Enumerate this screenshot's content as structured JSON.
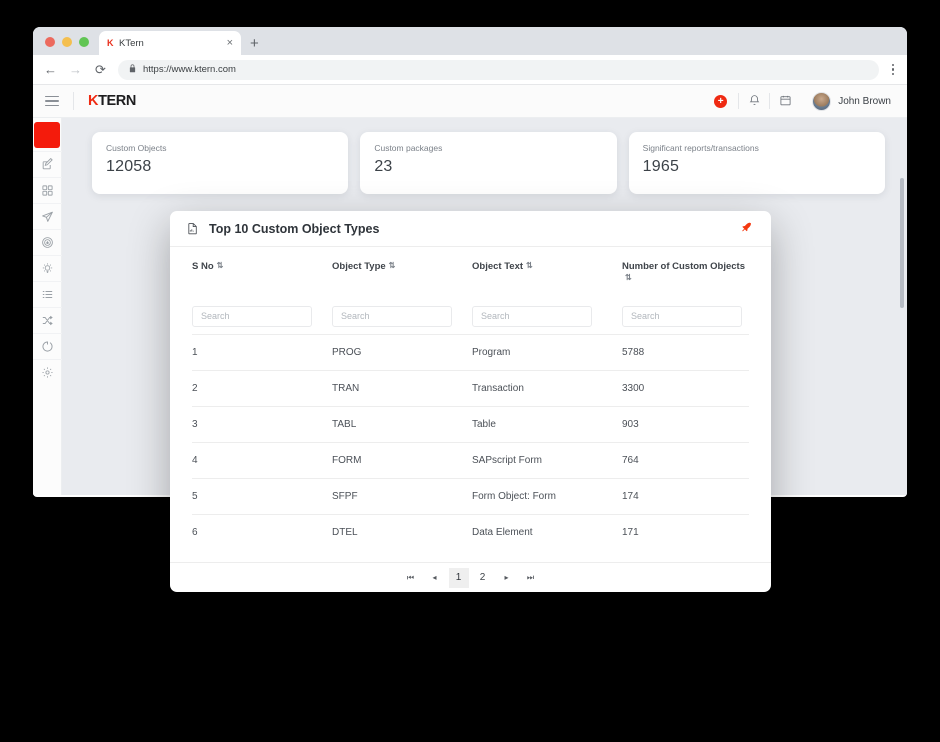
{
  "browser": {
    "tab": {
      "title": "KTern",
      "favicon_text": "K",
      "close_label": "×"
    },
    "new_tab_label": "+",
    "nav": {
      "back": "←",
      "forward": "→",
      "reload": "⟳"
    },
    "url": "https://www.ktern.com",
    "lock_icon": "🔒",
    "menu_icon": "kebab-menu-icon"
  },
  "appbar": {
    "logo_k": "K",
    "logo_rest": "TERN",
    "add_label": "+",
    "notifications_icon": "bell-icon",
    "calendar_icon": "calendar-icon",
    "user_name": "John Brown"
  },
  "sidebar": {
    "brand_color": "#f41b0c",
    "items": [
      {
        "name": "sidebar-item-edit",
        "icon": "pencil-square-icon"
      },
      {
        "name": "sidebar-item-apps",
        "icon": "grid-icon"
      },
      {
        "name": "sidebar-item-send",
        "icon": "paper-plane-icon"
      },
      {
        "name": "sidebar-item-target",
        "icon": "target-drop-icon"
      },
      {
        "name": "sidebar-item-insights",
        "icon": "lightbulb-icon"
      },
      {
        "name": "sidebar-item-list",
        "icon": "list-icon"
      },
      {
        "name": "sidebar-item-shuffle",
        "icon": "shuffle-icon"
      },
      {
        "name": "sidebar-item-progress",
        "icon": "circle-loading-icon"
      },
      {
        "name": "sidebar-item-settings",
        "icon": "gear-icon"
      }
    ]
  },
  "cards": [
    {
      "label": "Custom Objects",
      "value": "12058"
    },
    {
      "label": "Custom packages",
      "value": "23"
    },
    {
      "label": "Significant reports/transactions",
      "value": "1965"
    }
  ],
  "modal": {
    "icon": "document-report-icon",
    "title": "Top 10 Custom Object Types",
    "pin_icon": "pin-icon",
    "pin_color": "#f4380f",
    "table": {
      "columns": [
        {
          "label": "S No",
          "sort_icon": "⇅"
        },
        {
          "label": "Object Type",
          "sort_icon": "⇅"
        },
        {
          "label": "Object Text",
          "sort_icon": "⇅"
        },
        {
          "label": "Number of Custom Objects",
          "sort_icon": "⇅"
        }
      ],
      "search_placeholder": "Search",
      "search_values": [
        "",
        "",
        "",
        ""
      ],
      "rows": [
        {
          "s_no": "1",
          "object_type": "PROG",
          "object_text": "Program",
          "count": "5788"
        },
        {
          "s_no": "2",
          "object_type": "TRAN",
          "object_text": "Transaction",
          "count": "3300"
        },
        {
          "s_no": "3",
          "object_type": "TABL",
          "object_text": "Table",
          "count": "903"
        },
        {
          "s_no": "4",
          "object_type": "FORM",
          "object_text": "SAPscript Form",
          "count": "764"
        },
        {
          "s_no": "5",
          "object_type": "SFPF",
          "object_text": "Form Object: Form",
          "count": "174"
        },
        {
          "s_no": "6",
          "object_type": "DTEL",
          "object_text": "Data Element",
          "count": "171"
        }
      ]
    },
    "pagination": {
      "first": "⏮",
      "prev": "◂",
      "pages": [
        "1",
        "2"
      ],
      "active_page": "1",
      "next": "▸",
      "last": "⏭"
    }
  }
}
